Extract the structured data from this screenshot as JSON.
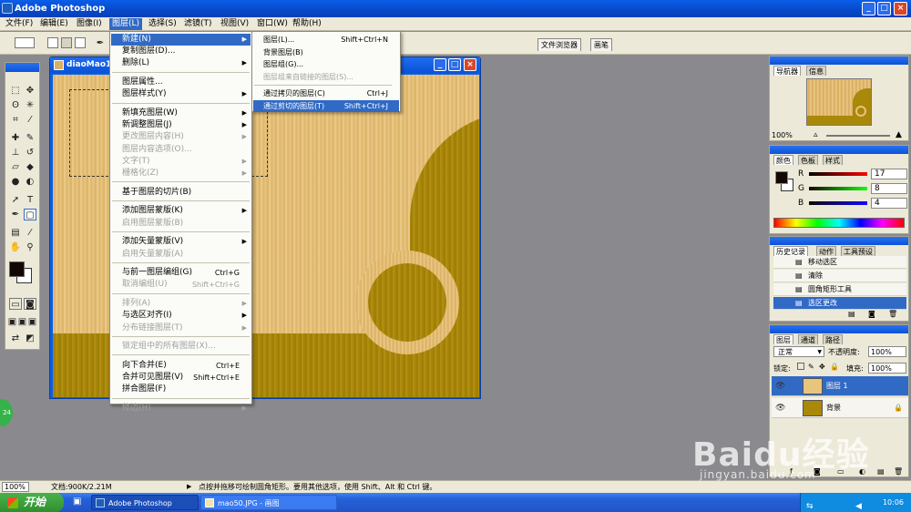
{
  "app": {
    "title": "Adobe Photoshop",
    "window_buttons": [
      "_",
      "□",
      "×"
    ]
  },
  "menubar": {
    "items": [
      "文件(F)",
      "编辑(E)",
      "图像(I)",
      "图层(L)",
      "选择(S)",
      "滤镜(T)",
      "视图(V)",
      "窗口(W)",
      "帮助(H)"
    ]
  },
  "options": {
    "palette_tabs": [
      "文件浏览器",
      "画笔"
    ]
  },
  "document": {
    "title": "diaoMao1"
  },
  "layer_menu": {
    "items": [
      {
        "label": "新建(N)",
        "arrow": true,
        "state": "selected"
      },
      {
        "label": "复制图层(D)...",
        "state": "normal"
      },
      {
        "label": "删除(L)",
        "arrow": true,
        "state": "normal"
      },
      {
        "label": "图层属性...",
        "state": "normal",
        "sep_before": true
      },
      {
        "label": "图层样式(Y)",
        "arrow": true,
        "state": "normal"
      },
      {
        "label": "新填充图层(W)",
        "arrow": true,
        "state": "normal",
        "sep_before": true
      },
      {
        "label": "新调整图层(J)",
        "arrow": true,
        "state": "normal"
      },
      {
        "label": "更改图层内容(H)",
        "arrow": true,
        "state": "disabled"
      },
      {
        "label": "图层内容选项(O)...",
        "state": "disabled"
      },
      {
        "label": "文字(T)",
        "arrow": true,
        "state": "disabled"
      },
      {
        "label": "栅格化(Z)",
        "arrow": true,
        "state": "disabled"
      },
      {
        "label": "基于图层的切片(B)",
        "state": "normal",
        "sep_before": true
      },
      {
        "label": "添加图层蒙版(K)",
        "arrow": true,
        "state": "normal",
        "sep_before": true
      },
      {
        "label": "启用图层蒙版(B)",
        "state": "disabled"
      },
      {
        "label": "添加矢量蒙版(V)",
        "arrow": true,
        "state": "normal",
        "sep_before": true
      },
      {
        "label": "启用矢量蒙版(A)",
        "state": "disabled"
      },
      {
        "label": "与前一图层编组(G)",
        "shortcut": "Ctrl+G",
        "state": "normal",
        "sep_before": true
      },
      {
        "label": "取消编组(U)",
        "shortcut": "Shift+Ctrl+G",
        "state": "disabled"
      },
      {
        "label": "排列(A)",
        "arrow": true,
        "state": "disabled",
        "sep_before": true
      },
      {
        "label": "与选区对齐(I)",
        "arrow": true,
        "state": "normal"
      },
      {
        "label": "分布链接图层(T)",
        "arrow": true,
        "state": "disabled"
      },
      {
        "label": "锁定组中的所有图层(X)...",
        "state": "disabled",
        "sep_before": true
      },
      {
        "label": "向下合并(E)",
        "shortcut": "Ctrl+E",
        "state": "normal",
        "sep_before": true
      },
      {
        "label": "合并可见图层(V)",
        "shortcut": "Shift+Ctrl+E",
        "state": "normal"
      },
      {
        "label": "拼合图层(F)",
        "state": "normal"
      },
      {
        "label": "修边(H)",
        "arrow": true,
        "state": "disabled",
        "sep_before": true
      }
    ]
  },
  "new_submenu": {
    "items": [
      {
        "label": "图层(L)...",
        "shortcut": "Shift+Ctrl+N",
        "state": "normal"
      },
      {
        "label": "背景图层(B)",
        "state": "normal"
      },
      {
        "label": "图层组(G)...",
        "state": "normal"
      },
      {
        "label": "图层组来自链接的图层(S)...",
        "state": "disabled"
      },
      {
        "label": "通过拷贝的图层(C)",
        "shortcut": "Ctrl+J",
        "state": "normal",
        "sep_before": true
      },
      {
        "label": "通过剪切的图层(T)",
        "shortcut": "Shift+Ctrl+J",
        "state": "selected"
      }
    ]
  },
  "navigator": {
    "tabs": [
      "导航器",
      "信息"
    ],
    "zoom": "100%"
  },
  "color": {
    "tabs": [
      "颜色",
      "色板",
      "样式"
    ],
    "channels": [
      {
        "label": "R",
        "value": "17"
      },
      {
        "label": "G",
        "value": "8"
      },
      {
        "label": "B",
        "value": "4"
      }
    ]
  },
  "history": {
    "tabs": [
      "历史记录",
      "动作",
      "工具预设"
    ],
    "items": [
      {
        "label": "移动选区",
        "selected": false
      },
      {
        "label": "清除",
        "selected": false
      },
      {
        "label": "圆角矩形工具",
        "selected": false
      },
      {
        "label": "选区更改",
        "selected": true
      }
    ]
  },
  "layers": {
    "tabs": [
      "图层",
      "通道",
      "路径"
    ],
    "blend_mode": "正常",
    "opacity_label": "不透明度:",
    "opacity": "100%",
    "lock_label": "锁定:",
    "fill_label": "填充:",
    "fill": "100%",
    "items": [
      {
        "name": "图层 1",
        "selected": true
      },
      {
        "name": "背景",
        "selected": false
      }
    ]
  },
  "status": {
    "zoom": "100%",
    "doc_size": "文档:900K/2.21M",
    "hint": "点按并拖移可绘制圆角矩形。要用其他选项，使用 Shift、Alt 和 Ctrl 键。"
  },
  "taskbar": {
    "start_label": "开始",
    "tasks": [
      "Adobe Photoshop",
      "mao50.JPG - 画图"
    ],
    "clock": "10:06"
  },
  "watermark": {
    "brand": "Baidu经验",
    "url": "jingyan.baidu.com"
  },
  "floating_badge": "24",
  "colors": {
    "menu_highlight": "#316ac5",
    "title_blue": "#0a5ee8",
    "wood_light": "#e8c47c",
    "wood_dark": "#a9880a"
  }
}
